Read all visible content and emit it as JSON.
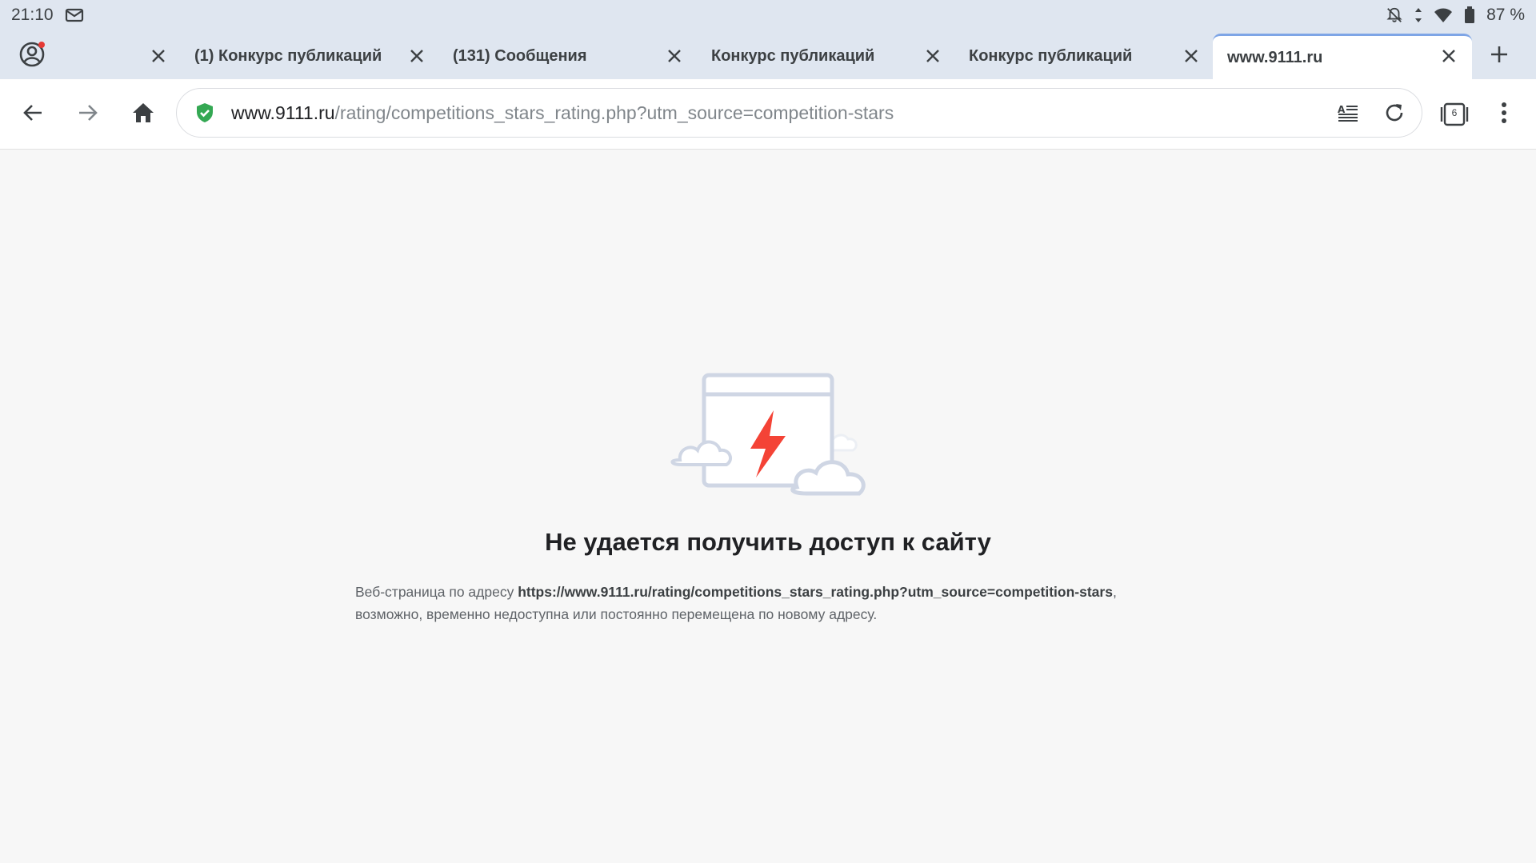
{
  "status_bar": {
    "time": "21:10",
    "battery": "87 %",
    "icons": [
      "mail-icon",
      "bell-off-icon",
      "signal-icon",
      "wifi-icon",
      "battery-icon"
    ]
  },
  "tabs": [
    {
      "label": "",
      "active": false
    },
    {
      "label": "(1) Конкурс публикаций",
      "active": false
    },
    {
      "label": "(131) Сообщения",
      "active": false
    },
    {
      "label": "Конкурс публикаций",
      "active": false
    },
    {
      "label": "Конкурс публикаций",
      "active": false
    },
    {
      "label": "www.9111.ru",
      "active": true
    }
  ],
  "toolbar": {
    "url_host": "www.9111.ru",
    "url_path": "/rating/competitions_stars_rating.php?utm_source=competition-stars",
    "tab_count": "6"
  },
  "error": {
    "title": "Не удается получить доступ к сайту",
    "desc_prefix": "Веб-страница по адресу ",
    "desc_url": "https://www.9111.ru/rating/competitions_stars_rating.php?utm_source=competition-stars",
    "desc_suffix": ", возможно, временно недоступна или постоянно перемещена по новому адресу."
  },
  "colors": {
    "chrome_bg": "#dfe6f0",
    "page_bg": "#f7f7f7",
    "accent": "#7ea5e6",
    "secure": "#34a853",
    "bolt": "#f44336"
  }
}
